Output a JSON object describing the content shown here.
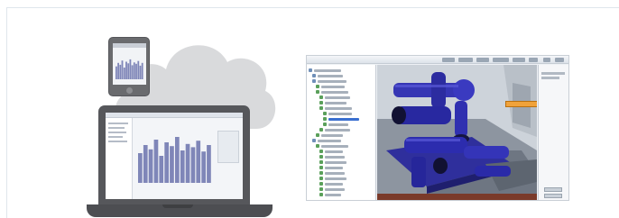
{
  "illustration": {
    "cloud_color": "#d9dadc",
    "device_color": "#56575b",
    "chart_bar_color": "#7f86b8",
    "chart_bar_levels": [
      0.55,
      0.7,
      0.62,
      0.8,
      0.5,
      0.75,
      0.68,
      0.85,
      0.6,
      0.72,
      0.66,
      0.78,
      0.58,
      0.7
    ]
  },
  "app_screenshot": {
    "accent_color": "#2a2a8a",
    "callout_color": "#f0a23a",
    "callout_text": ""
  }
}
